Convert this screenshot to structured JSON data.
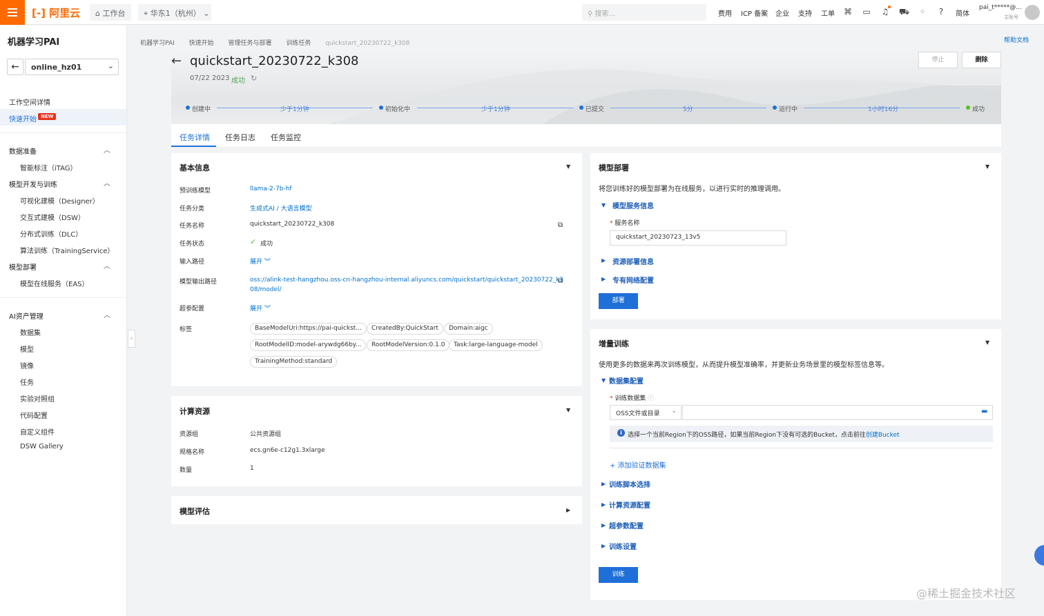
{
  "topbar": {
    "logo": "[-] 阿里云",
    "workbench": "工作台",
    "region": "华东1（杭州）",
    "search_placeholder": "搜索...",
    "nav": [
      "费用",
      "ICP 备案",
      "企业",
      "支持",
      "工单"
    ],
    "lang": "简体",
    "user": "pai_t*****@...",
    "user_role": "主账号"
  },
  "sidebar": {
    "title": "机器学习PAI",
    "workspace": "online_hz01",
    "workspace_detail": "工作空间详情",
    "quickstart": "快速开始",
    "new_badge": "NEW",
    "groups": [
      {
        "label": "数据准备",
        "items": [
          "智能标注（iTAG）"
        ]
      },
      {
        "label": "模型开发与训练",
        "items": [
          "可视化建模（Designer）",
          "交互式建模（DSW）",
          "分布式训练（DLC）",
          "算法训练（TrainingService）"
        ]
      },
      {
        "label": "模型部署",
        "items": [
          "模型在线服务（EAS）"
        ]
      },
      {
        "label": "AI资产管理",
        "items": [
          "数据集",
          "模型",
          "镜像",
          "任务",
          "实验对照组",
          "代码配置",
          "自定义组件",
          "DSW Gallery"
        ]
      }
    ]
  },
  "breadcrumb": [
    "机器学习PAI",
    "快速开始",
    "管理任务与部署",
    "训练任务",
    "quickstart_20230722_k308"
  ],
  "help_doc": "帮助文档",
  "header": {
    "title": "quickstart_20230722_k308",
    "date": "07/22 2023",
    "status": "成功",
    "stop": "停止",
    "delete": "删除"
  },
  "progress": {
    "steps": [
      "创建中",
      "初始化中",
      "已提交",
      "运行中",
      "成功"
    ],
    "durations": [
      "少于1分钟",
      "少于1分钟",
      "5分",
      "1小时16分"
    ]
  },
  "tabs": [
    "任务详情",
    "任务日志",
    "任务监控"
  ],
  "basic_info": {
    "title": "基本信息",
    "rows": [
      {
        "label": "预训练模型",
        "value": "llama-2-7b-hf"
      },
      {
        "label": "任务分类",
        "value": "生成式AI / 大语言模型"
      },
      {
        "label": "任务名称",
        "value": "quickstart_20230722_k308"
      },
      {
        "label": "任务状态",
        "value": "成功"
      },
      {
        "label": "输入路径",
        "value": "展开"
      },
      {
        "label": "模型输出路径",
        "value": "oss://alink-test-hangzhou.oss-cn-hangzhou-internal.aliyuncs.com/quickstart/quickstart_20230722_k3",
        "value2": "08/model/"
      },
      {
        "label": "超参配置",
        "value": "展开"
      },
      {
        "label": "标签",
        "value": ""
      }
    ],
    "tags": [
      "BaseModelUri:https://pai-quickst...",
      "CreatedBy:QuickStart",
      "Domain:aigc",
      "RootModelID:model-arywdg66by...",
      "RootModelVersion:0.1.0",
      "Task:large-language-model",
      "TrainingMethod:standard"
    ]
  },
  "compute": {
    "title": "计算资源",
    "rows": [
      {
        "label": "资源组",
        "value": "公共资源组"
      },
      {
        "label": "规格名称",
        "value": "ecs.gn6e-c12g1.3xlarge"
      },
      {
        "label": "数量",
        "value": "1"
      }
    ]
  },
  "evaluation": {
    "title": "模型评估"
  },
  "deploy": {
    "title": "模型部署",
    "desc": "将您训练好的模型部署为在线服务，以进行实时的推理调用。",
    "service_info": "模型服务信息",
    "service_name_label": "服务名称",
    "service_name": "quickstart_20230723_13v5",
    "resource_info": "资源部署信息",
    "vpc_config": "专有网络配置",
    "deploy_button": "部署"
  },
  "incremental": {
    "title": "增量训练",
    "desc": "使用更多的数据来再次训练模型，从而提升模型准确率，并更新业务场景里的模型标签信息等。",
    "dataset_config": "数据集配置",
    "train_dataset_label": "训练数据集",
    "source_select": "OSS文件或目录",
    "info_text": "选择一个当前Region下的OSS路径，如果当前Region下没有可选的Bucket，点击前往",
    "info_link": "创建Bucket",
    "add_validation": "+ 添加验证数据集",
    "sections": [
      "训练脚本选择",
      "计算资源配置",
      "超参数配置",
      "训练设置"
    ],
    "train_button": "训练"
  },
  "watermark": "@稀土掘金技术社区"
}
